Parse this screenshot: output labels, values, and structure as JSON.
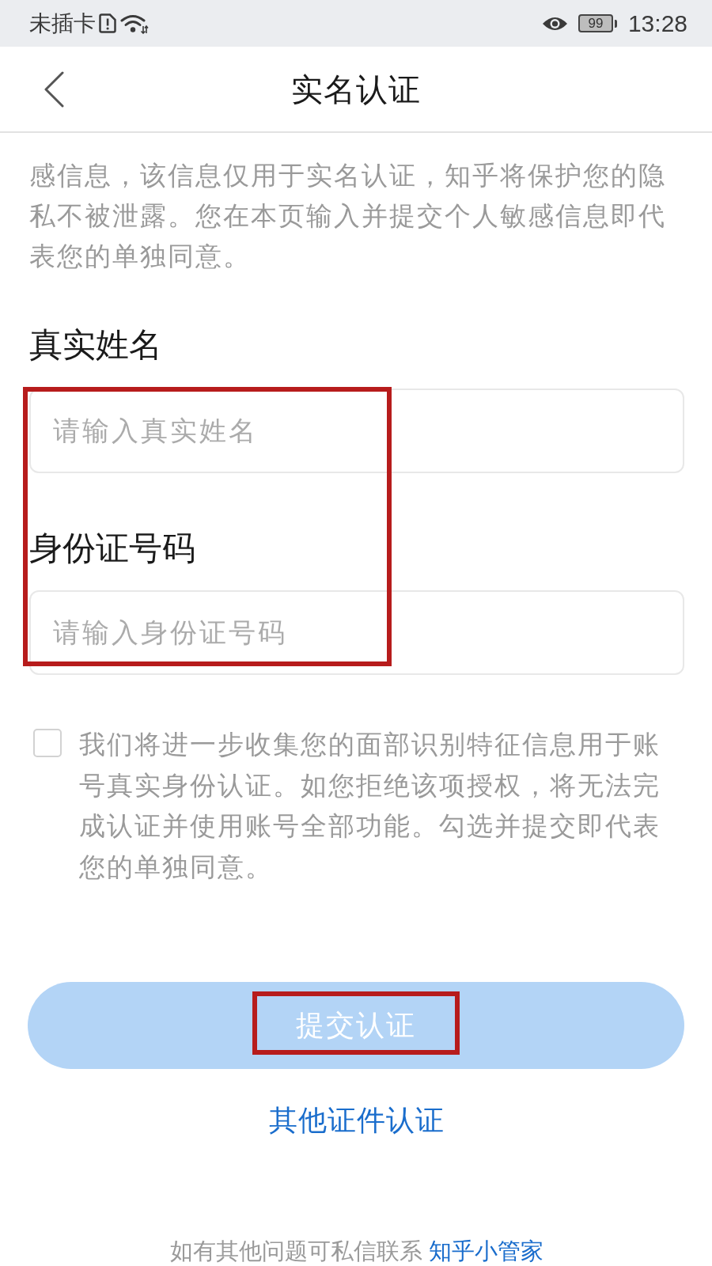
{
  "status_bar": {
    "carrier": "未插卡",
    "battery": "99",
    "time": "13:28"
  },
  "header": {
    "title": "实名认证"
  },
  "notice": "感信息，该信息仅用于实名认证，知乎将保护您的隐私不被泄露。您在本页输入并提交个人敏感信息即代表您的单独同意。",
  "form": {
    "highlighted": true,
    "fields": [
      {
        "label": "真实姓名",
        "placeholder": "请输入真实姓名"
      },
      {
        "label": "身份证号码",
        "placeholder": "请输入身份证号码"
      }
    ]
  },
  "consent": {
    "checked": false,
    "text": "我们将进一步收集您的面部识别特征信息用于账号真实身份认证。如您拒绝该项授权，将无法完成认证并使用账号全部功能。勾选并提交即代表您的单独同意。"
  },
  "submit_button": {
    "label": "提交认证",
    "disabled": true,
    "highlighted": true
  },
  "other_link": "其他证件认证",
  "footer": {
    "text": "如有其他问题可私信联系",
    "link": "知乎小管家"
  }
}
